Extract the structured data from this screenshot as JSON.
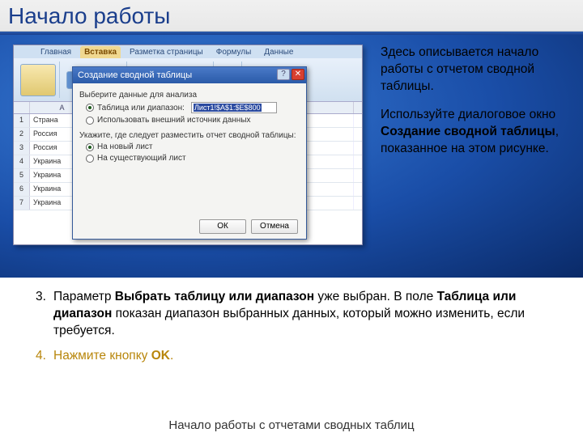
{
  "slide": {
    "title": "Начало работы",
    "footer": "Начало работы с отчетами сводных таблиц"
  },
  "right": {
    "p1": "Здесь описывается начало работы с отчетом сводной таблицы.",
    "p2a": "Используйте диалоговое окно ",
    "p2b": "Создание сводной таблицы",
    "p2c": ", показанное на этом рисунке."
  },
  "bullets": {
    "n3": "3.",
    "t3a": "Параметр ",
    "t3b": "Выбрать таблицу или диапазон",
    "t3c": " уже выбран. В поле ",
    "t3d": "Таблица или диапазон",
    "t3e": " показан диапазон выбранных данных, который можно изменить, если требуется.",
    "n4": "4.",
    "t4a": "Нажмите кнопку ",
    "t4b": "OK",
    "t4c": "."
  },
  "excel": {
    "tabs": {
      "t1": "Главная",
      "t2": "Вставка",
      "t3": "Разметка страницы",
      "t4": "Формулы",
      "t5": "Данные"
    },
    "colA": "A",
    "rows": {
      "r1": "1",
      "c1a": "Страна",
      "r2": "2",
      "c2a": "Россия",
      "r3": "3",
      "c3a": "Россия",
      "r4": "4",
      "c4a": "Украина",
      "r5": "5",
      "c5a": "Украина",
      "r6": "6",
      "c6a": "Украина",
      "r7": "7",
      "c7a": "Украина"
    }
  },
  "dialog": {
    "title": "Создание сводной таблицы",
    "line1": "Выберите данные для анализа",
    "opt1": "Таблица или диапазон:",
    "range": "Лист1!$A$1:$E$800",
    "opt2": "Использовать внешний источник данных",
    "line2": "Укажите, где следует разместить отчет сводной таблицы:",
    "opt3": "На новый лист",
    "opt4": "На существующий лист",
    "ok": "ОК",
    "cancel": "Отмена"
  }
}
